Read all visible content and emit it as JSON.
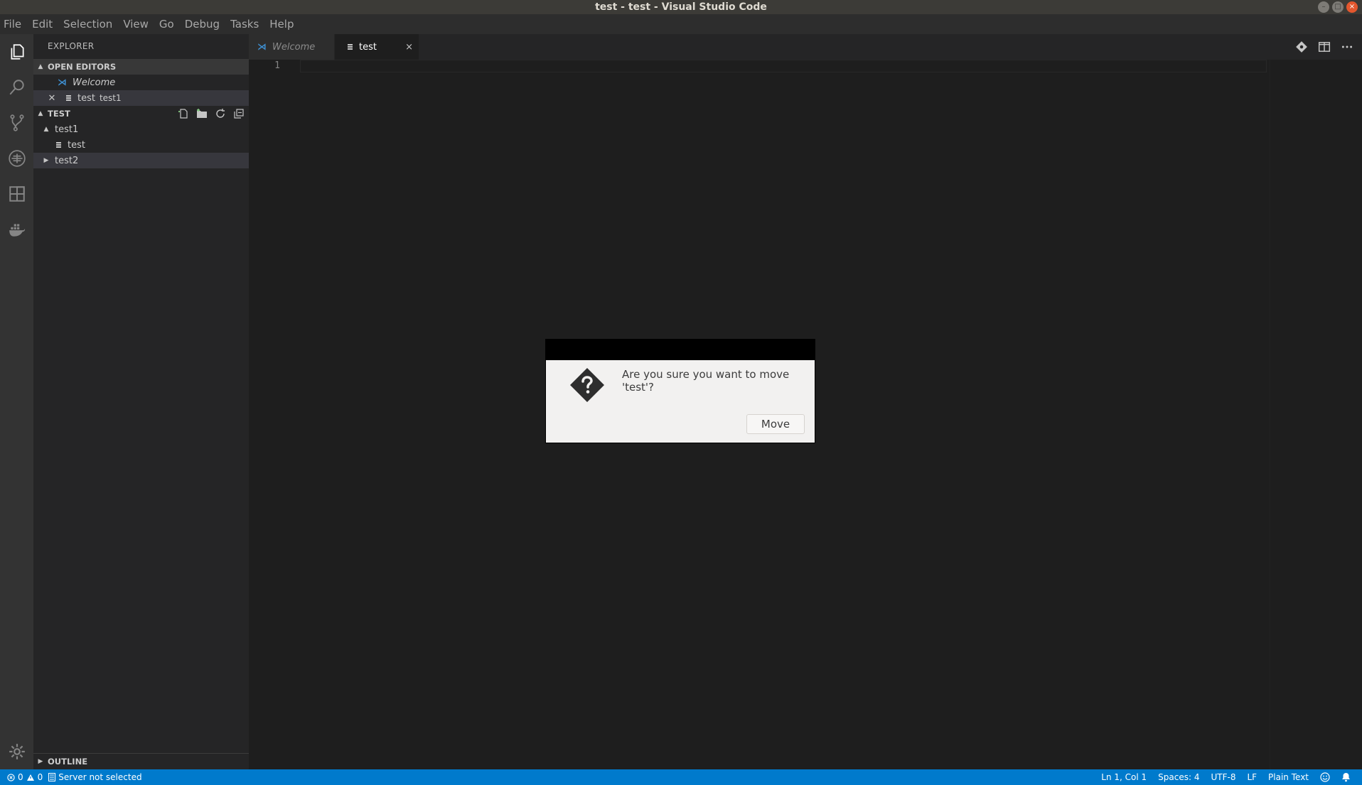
{
  "window": {
    "title": "test - test - Visual Studio Code",
    "minimize": "–",
    "maximize": "□",
    "close": "×"
  },
  "menu": [
    "File",
    "Edit",
    "Selection",
    "View",
    "Go",
    "Debug",
    "Tasks",
    "Help"
  ],
  "activity_bar": [
    "explorer-icon",
    "search-icon",
    "source-control-icon",
    "debug-icon",
    "extensions-icon",
    "docker-icon",
    "gear-icon"
  ],
  "sidebar": {
    "header": "EXPLORER",
    "open_editors": {
      "label": "OPEN EDITORS",
      "items": [
        {
          "name": "Welcome",
          "icon": "vscode-icon",
          "italic": true
        },
        {
          "name": "test",
          "description": "test1",
          "icon": "file-icon"
        }
      ]
    },
    "folder": {
      "label": "TEST",
      "actions": [
        "new-file-icon",
        "new-folder-icon",
        "refresh-icon",
        "collapse-all-icon"
      ],
      "tree": [
        {
          "name": "test1",
          "expanded": true
        },
        {
          "name": "test",
          "parent": "test1"
        },
        {
          "name": "test2",
          "expanded": false
        }
      ]
    },
    "outline": "OUTLINE"
  },
  "tabs": [
    {
      "label": "Welcome",
      "active": false,
      "italic": true
    },
    {
      "label": "test",
      "active": true,
      "close": "×"
    }
  ],
  "editor": {
    "line_numbers": [
      "1"
    ],
    "content": ""
  },
  "dialog": {
    "message": "Are you sure you want to move 'test'?",
    "button": "Move"
  },
  "status_bar": {
    "errors": "0",
    "warnings": "0",
    "server": "Server not selected",
    "position": "Ln 1, Col 1",
    "spaces": "Spaces: 4",
    "encoding": "UTF-8",
    "eol": "LF",
    "language": "Plain Text"
  },
  "colors": {
    "status_bar": "#007acc",
    "activity_bar": "#333333",
    "sidebar": "#252526",
    "editor": "#1e1e1e",
    "dialog": "#f2f1f0"
  }
}
